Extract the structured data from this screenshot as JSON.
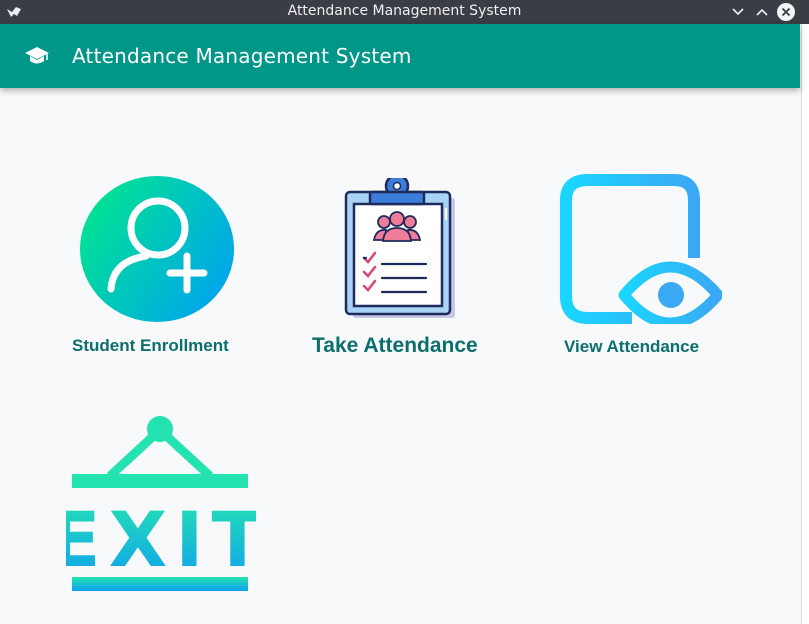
{
  "window": {
    "title": "Attendance Management System"
  },
  "header": {
    "title": "Attendance Management System",
    "icon": "school-icon"
  },
  "tiles": [
    {
      "label": "Student Enrollment",
      "icon": "add-user-icon"
    },
    {
      "label": "Take Attendance",
      "icon": "clipboard-checklist-icon"
    },
    {
      "label": "View Attendance",
      "icon": "document-eye-icon"
    },
    {
      "label": "EXIT",
      "icon": "exit-sign-icon"
    }
  ],
  "colors": {
    "primary": "#009688",
    "label": "#0d6e6e",
    "title_bar": "#3a3e44",
    "accent_gradient_start": "#1de9b6",
    "accent_gradient_end": "#00b0ff"
  }
}
